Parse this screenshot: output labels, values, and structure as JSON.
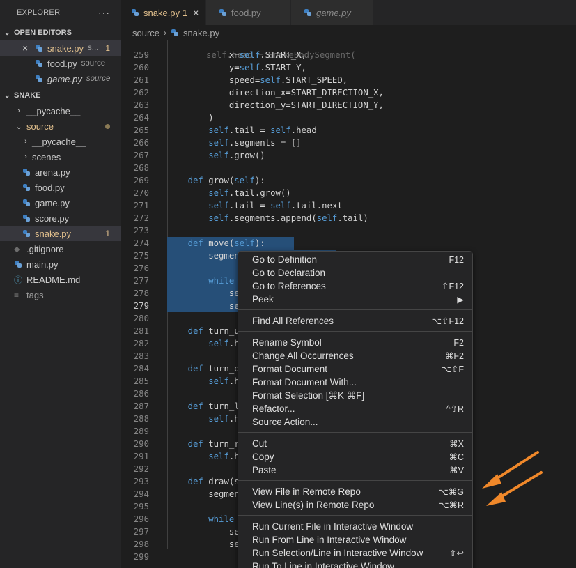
{
  "sidebar": {
    "title": "EXPLORER",
    "more": "···",
    "open_editors": {
      "header": "OPEN EDITORS",
      "items": [
        {
          "name": "snake.py",
          "desc": "s...",
          "badge": "1"
        },
        {
          "name": "food.py",
          "desc": "source"
        },
        {
          "name": "game.py",
          "desc": "source"
        }
      ]
    },
    "project": {
      "header": "SNAKE",
      "items": [
        {
          "name": "__pycache__"
        },
        {
          "name": "source"
        },
        {
          "name": "__pycache__"
        },
        {
          "name": "scenes"
        },
        {
          "name": "arena.py"
        },
        {
          "name": "food.py"
        },
        {
          "name": "game.py"
        },
        {
          "name": "score.py"
        },
        {
          "name": "snake.py",
          "badge": "1"
        },
        {
          "name": ".gitignore"
        },
        {
          "name": "main.py"
        },
        {
          "name": "README.md"
        },
        {
          "name": "tags"
        }
      ]
    }
  },
  "tabs": [
    {
      "label": "snake.py",
      "badge": "1",
      "close": "×"
    },
    {
      "label": "food.py"
    },
    {
      "label": "game.py"
    }
  ],
  "breadcrumb": {
    "folder": "source",
    "sep": "›",
    "file": "snake.py"
  },
  "editor": {
    "lines": [
      {
        "n": "259",
        "code": "            x=self.START_X,"
      },
      {
        "n": "260",
        "code": "            y=self.START_Y,"
      },
      {
        "n": "261",
        "code": "            speed=self.START_SPEED,"
      },
      {
        "n": "262",
        "code": "            direction_x=START_DIRECTION_X,"
      },
      {
        "n": "263",
        "code": "            direction_y=START_DIRECTION_Y,"
      },
      {
        "n": "264",
        "code": "        )"
      },
      {
        "n": "265",
        "code": "        self.tail = self.head"
      },
      {
        "n": "266",
        "code": "        self.segments = []"
      },
      {
        "n": "267",
        "code": "        self.grow()"
      },
      {
        "n": "268",
        "code": ""
      },
      {
        "n": "269",
        "code": "    def grow(self):"
      },
      {
        "n": "270",
        "code": "        self.tail.grow()"
      },
      {
        "n": "271",
        "code": "        self.tail = self.tail.next"
      },
      {
        "n": "272",
        "code": "        self.segments.append(self.tail)"
      },
      {
        "n": "273",
        "code": ""
      },
      {
        "n": "274",
        "code": "    def move(self):"
      },
      {
        "n": "275",
        "code": "        segmen"
      },
      {
        "n": "276",
        "code": ""
      },
      {
        "n": "277",
        "code": "        while"
      },
      {
        "n": "278",
        "code": "            se"
      },
      {
        "n": "279",
        "code": "            se"
      },
      {
        "n": "280",
        "code": ""
      },
      {
        "n": "281",
        "code": "    def turn_u"
      },
      {
        "n": "282",
        "code": "        self.h"
      },
      {
        "n": "283",
        "code": ""
      },
      {
        "n": "284",
        "code": "    def turn_d"
      },
      {
        "n": "285",
        "code": "        self.h"
      },
      {
        "n": "286",
        "code": ""
      },
      {
        "n": "287",
        "code": "    def turn_l"
      },
      {
        "n": "288",
        "code": "        self.h"
      },
      {
        "n": "289",
        "code": ""
      },
      {
        "n": "290",
        "code": "    def turn_r"
      },
      {
        "n": "291",
        "code": "        self.h"
      },
      {
        "n": "292",
        "code": ""
      },
      {
        "n": "293",
        "code": "    def draw(s"
      },
      {
        "n": "294",
        "code": "        segmen"
      },
      {
        "n": "295",
        "code": ""
      },
      {
        "n": "296",
        "code": "        while"
      },
      {
        "n": "297",
        "code": "            se"
      },
      {
        "n": "298",
        "code": "            se"
      },
      {
        "n": "299",
        "code": ""
      }
    ]
  },
  "context_menu": {
    "groups": [
      [
        {
          "label": "Go to Definition",
          "kb": "F12"
        },
        {
          "label": "Go to Declaration",
          "kb": ""
        },
        {
          "label": "Go to References",
          "kb": "⇧F12"
        },
        {
          "label": "Peek",
          "kb": "▶"
        }
      ],
      [
        {
          "label": "Find All References",
          "kb": "⌥⇧F12"
        }
      ],
      [
        {
          "label": "Rename Symbol",
          "kb": "F2"
        },
        {
          "label": "Change All Occurrences",
          "kb": "⌘F2"
        },
        {
          "label": "Format Document",
          "kb": "⌥⇧F"
        },
        {
          "label": "Format Document With...",
          "kb": ""
        },
        {
          "label": "Format Selection [⌘K ⌘F]",
          "kb": ""
        },
        {
          "label": "Refactor...",
          "kb": "^⇧R"
        },
        {
          "label": "Source Action...",
          "kb": ""
        }
      ],
      [
        {
          "label": "Cut",
          "kb": "⌘X"
        },
        {
          "label": "Copy",
          "kb": "⌘C"
        },
        {
          "label": "Paste",
          "kb": "⌘V"
        }
      ],
      [
        {
          "label": "View File in Remote Repo",
          "kb": "⌥⌘G"
        },
        {
          "label": "View Line(s) in Remote Repo",
          "kb": "⌥⌘R"
        }
      ],
      [
        {
          "label": "Run Current File in Interactive Window",
          "kb": ""
        },
        {
          "label": "Run From Line in Interactive Window",
          "kb": ""
        },
        {
          "label": "Run Selection/Line in Interactive Window",
          "kb": "⇧↩"
        },
        {
          "label": "Run To Line in Interactive Window",
          "kb": ""
        }
      ]
    ]
  },
  "colors": {
    "accent_arrow": "#f0882a",
    "modified": "#e2c08d",
    "selection": "#264f78"
  }
}
